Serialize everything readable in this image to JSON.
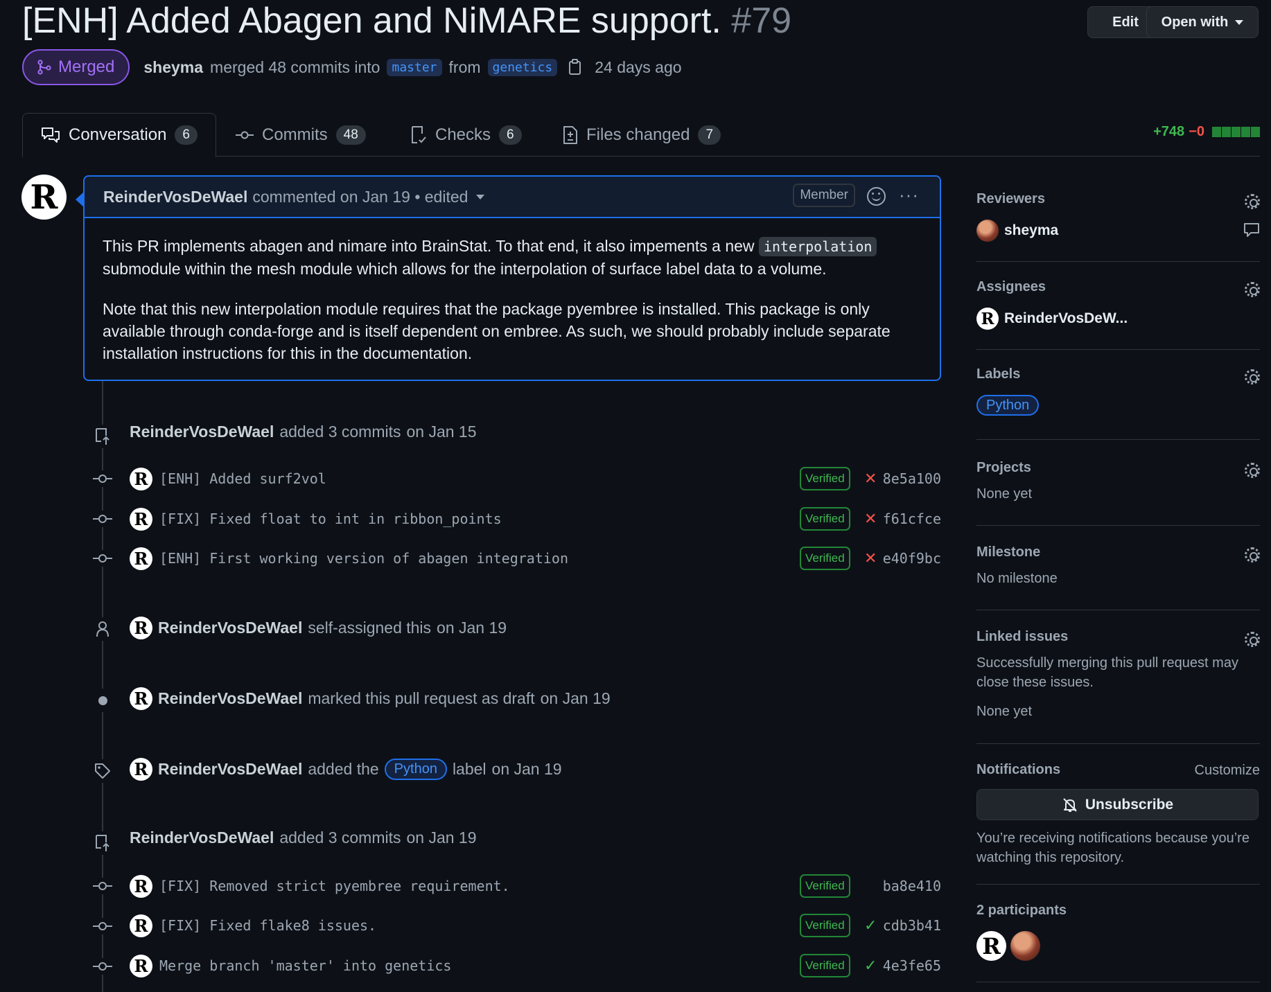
{
  "header": {
    "title": "[ENH] Added Abagen and NiMARE support.",
    "number": "#79",
    "edit_label": "Edit",
    "open_with_label": "Open with"
  },
  "meta": {
    "status": "Merged",
    "author": "sheyma",
    "action": "merged 48 commits into",
    "base_branch": "master",
    "from_word": "from",
    "head_branch": "genetics",
    "time": "24 days ago"
  },
  "tabs": [
    {
      "label": "Conversation",
      "count": "6",
      "icon": "comment-discussion-icon"
    },
    {
      "label": "Commits",
      "count": "48",
      "icon": "git-commit-icon"
    },
    {
      "label": "Checks",
      "count": "6",
      "icon": "checklist-icon"
    },
    {
      "label": "Files changed",
      "count": "7",
      "icon": "file-diff-icon"
    }
  ],
  "diffstat": {
    "additions": "+748",
    "deletions": "−0"
  },
  "comment": {
    "author": "ReinderVosDeWael",
    "meta": "commented on Jan 19 • edited",
    "role": "Member",
    "para1_before": "This PR implements abagen and nimare into BrainStat. To that end, it also impements a new",
    "para1_code": "interpolation",
    "para1_after": "submodule within the mesh module which allows for the interpolation of surface label data to a volume.",
    "para2": "Note that this new interpolation module requires that the package pyembree is installed. This package is only available through conda-forge and is itself dependent on embree. As such, we should probably include separate installation instructions for this in the documentation."
  },
  "timeline": {
    "commits_group1": {
      "author": "ReinderVosDeWael",
      "text": "added 3 commits",
      "date": "on Jan 15"
    },
    "commits1": [
      {
        "message": "[ENH] Added surf2vol",
        "verified": "Verified",
        "status": "fail",
        "sha": "8e5a100"
      },
      {
        "message": "[FIX] Fixed float to int in ribbon_points",
        "verified": "Verified",
        "status": "fail",
        "sha": "f61cfce"
      },
      {
        "message": "[ENH] First working version of abagen integration",
        "verified": "Verified",
        "status": "fail",
        "sha": "e40f9bc"
      }
    ],
    "self_assigned": {
      "author": "ReinderVosDeWael",
      "text": "self-assigned this",
      "date": "on Jan 19"
    },
    "draft": {
      "author": "ReinderVosDeWael",
      "text": "marked this pull request as draft",
      "date": "on Jan 19"
    },
    "label_event": {
      "author": "ReinderVosDeWael",
      "text_before": "added the",
      "label": "Python",
      "text_after": "label",
      "date": "on Jan 19"
    },
    "commits_group2": {
      "author": "ReinderVosDeWael",
      "text": "added 3 commits",
      "date": "on Jan 19"
    },
    "commits2": [
      {
        "message": "[FIX] Removed strict pyembree requirement.",
        "verified": "Verified",
        "status": "none",
        "sha": "ba8e410"
      },
      {
        "message": "[FIX] Fixed flake8 issues.",
        "verified": "Verified",
        "status": "success",
        "sha": "cdb3b41"
      },
      {
        "message": "Merge branch 'master' into genetics",
        "verified": "Verified",
        "status": "success",
        "sha": "4e3fe65"
      }
    ]
  },
  "sidebar": {
    "reviewers": {
      "title": "Reviewers",
      "name": "sheyma"
    },
    "assignees": {
      "title": "Assignees",
      "name": "ReinderVosDeW..."
    },
    "labels": {
      "title": "Labels",
      "label": "Python"
    },
    "projects": {
      "title": "Projects",
      "value": "None yet"
    },
    "milestone": {
      "title": "Milestone",
      "value": "No milestone"
    },
    "linked_issues": {
      "title": "Linked issues",
      "description": "Successfully merging this pull request may close these issues.",
      "value": "None yet"
    },
    "notifications": {
      "title": "Notifications",
      "customize": "Customize",
      "button": "Unsubscribe",
      "reason": "You’re receiving notifications because you’re watching this repository."
    },
    "participants": {
      "title": "2 participants"
    }
  },
  "colors": {
    "merged": "#8957e5",
    "accent": "#1f6feb",
    "success": "#3fb950",
    "danger": "#f85149"
  }
}
